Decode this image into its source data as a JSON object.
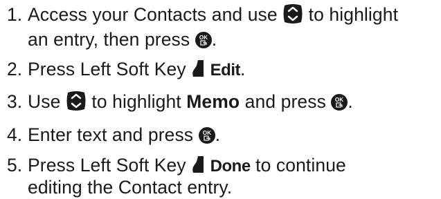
{
  "steps": [
    {
      "number": "1.",
      "line1": {
        "before": "Access your Contacts and use",
        "after": "to highlight"
      },
      "line2": {
        "before": "an entry, then press",
        "after": "."
      }
    },
    {
      "number": "2.",
      "text": "Press Left Soft Key",
      "soft_label": "Edit",
      "after": "."
    },
    {
      "number": "3.",
      "before": "Use",
      "middle": "to highlight",
      "bold": "Memo",
      "after_bold": "and press",
      "end": "."
    },
    {
      "number": "4.",
      "text": "Enter text and press",
      "after": "."
    },
    {
      "number": "5.",
      "line1": {
        "before": "Press Left Soft Key",
        "soft_label": "Done",
        "after": "to continue"
      },
      "line2": "editing the Contact entry."
    }
  ],
  "icons": {
    "nav": "navigation-key-icon",
    "ok": "ok-key-icon",
    "left_soft": "left-soft-key-icon"
  },
  "colors": {
    "text": "#1a1a1a",
    "icon": "#1a1a1a"
  }
}
